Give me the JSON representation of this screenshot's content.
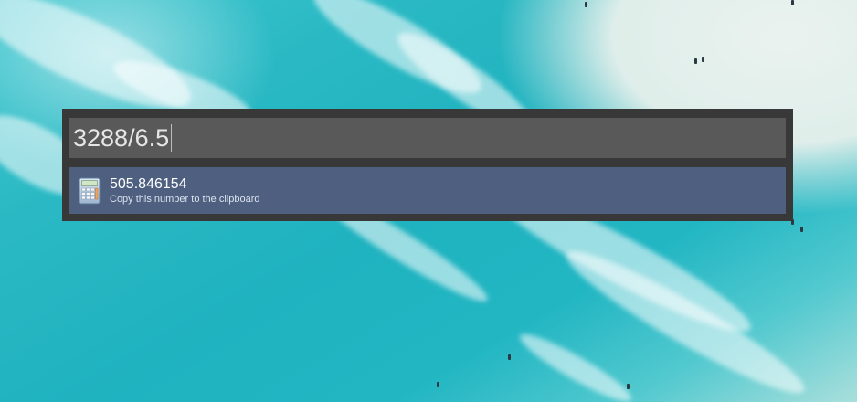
{
  "launcher": {
    "query": "3288/6.5",
    "results": [
      {
        "title": "505.846154",
        "subtitle": "Copy this number to the clipboard",
        "icon": "calculator-icon"
      }
    ]
  },
  "colors": {
    "panel": "#383838",
    "input_bg": "#595959",
    "selected_result": "#4e5f80"
  }
}
